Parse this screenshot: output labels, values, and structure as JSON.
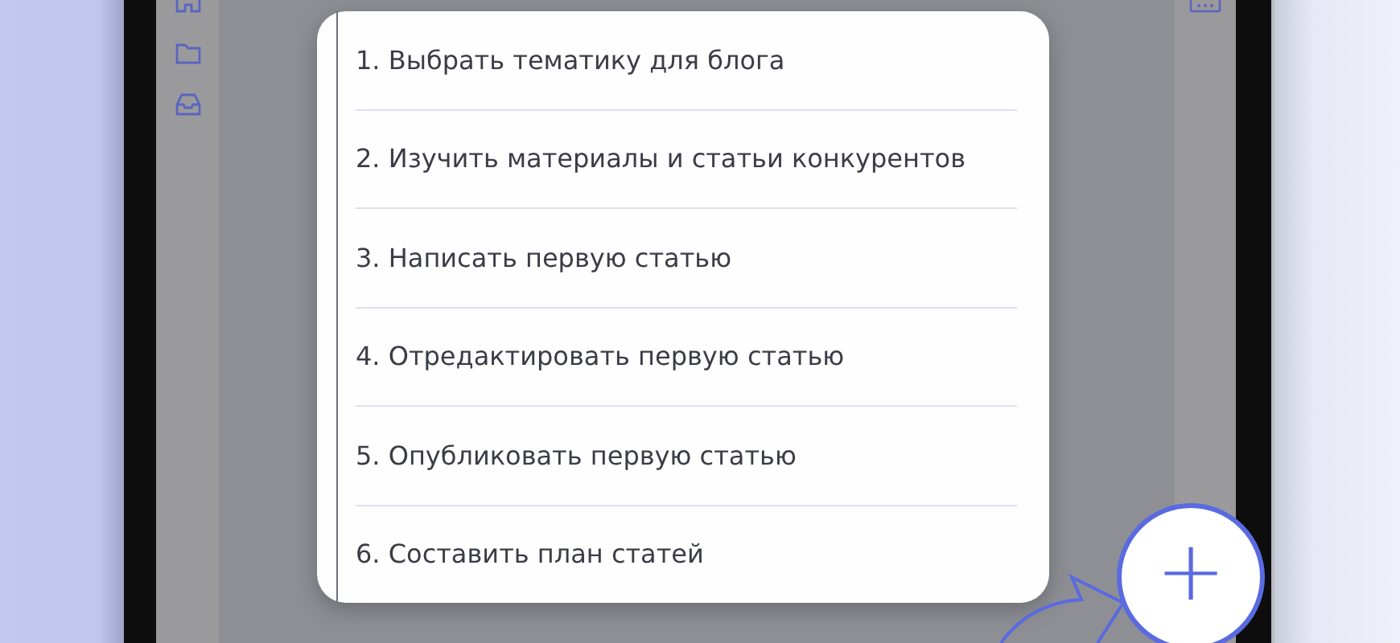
{
  "tasks": [
    {
      "label": "1. Выбрать тематику для блога"
    },
    {
      "label": "2. Изучить материалы и статьи конкурентов"
    },
    {
      "label": "3. Написать первую статью"
    },
    {
      "label": "4. Отредактировать первую статью"
    },
    {
      "label": "5. Опубликовать первую статью"
    },
    {
      "label": "6. Составить план статей"
    }
  ],
  "fab": {
    "symbol": "+"
  }
}
